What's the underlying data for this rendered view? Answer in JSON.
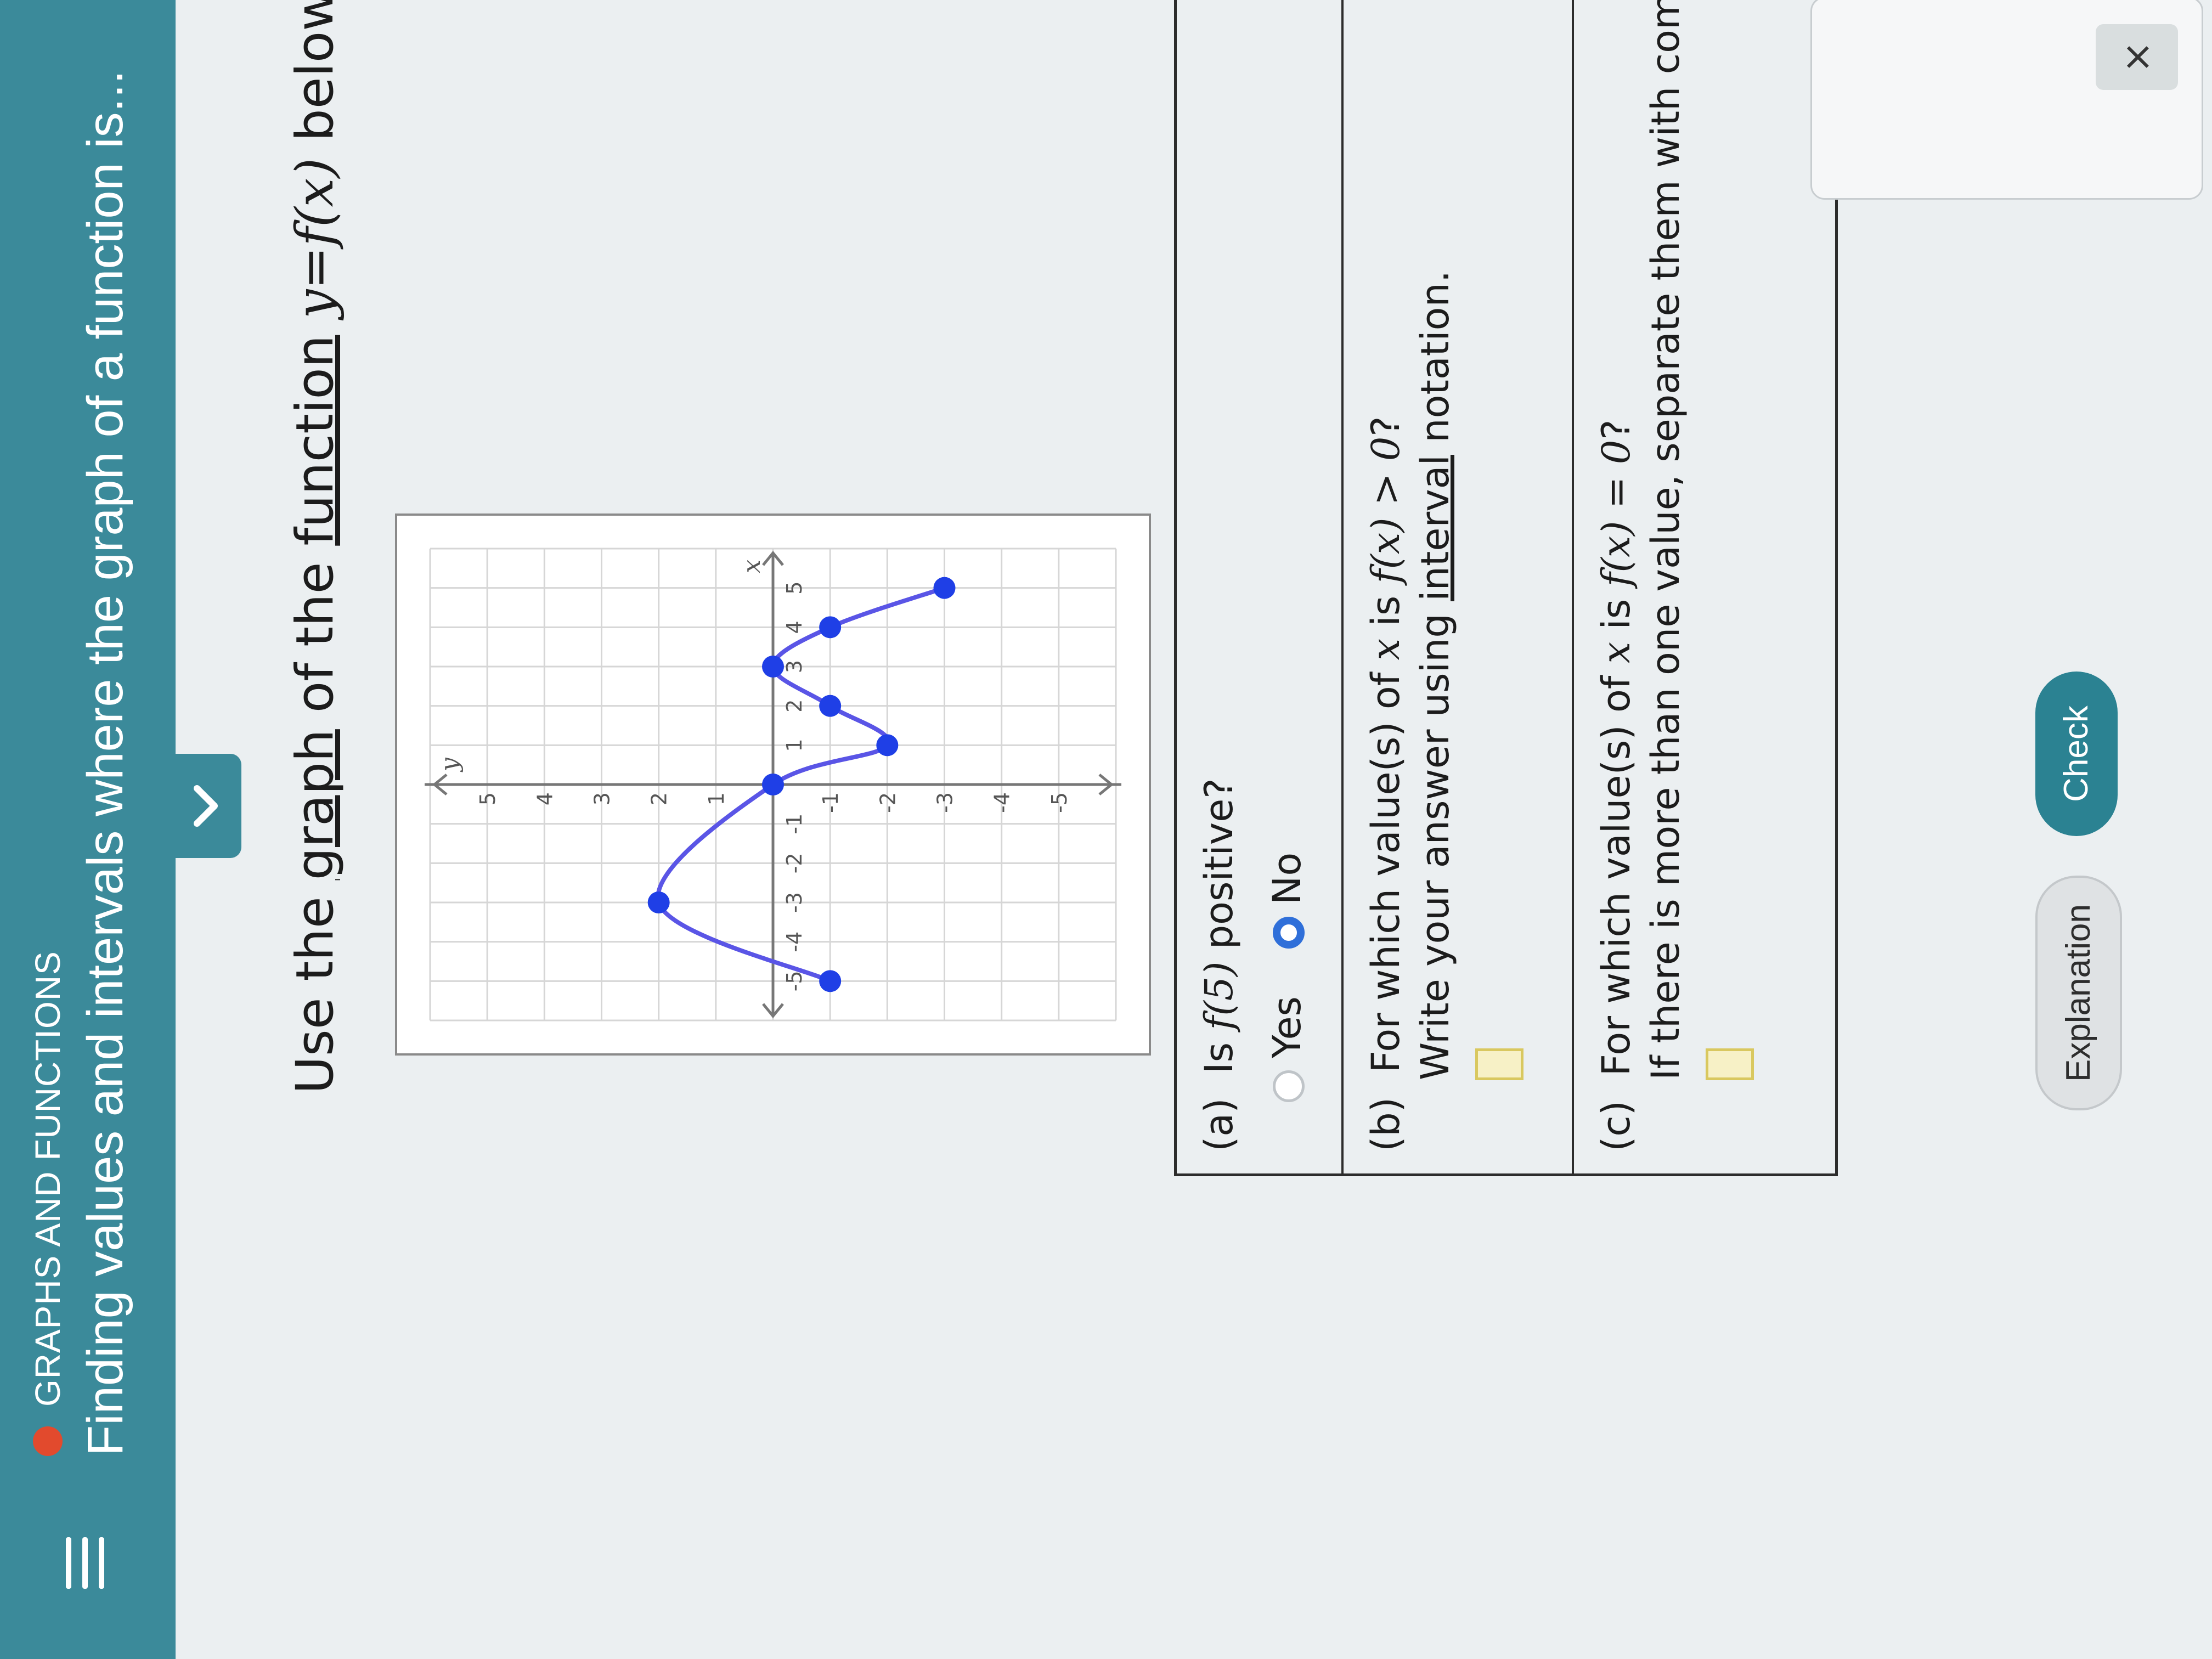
{
  "header": {
    "menu_icon": "hamburger-icon",
    "status_color": "#e24a2d",
    "topic": "GRAPHS AND FUNCTIONS",
    "lesson_title": "Finding values and intervals where the graph of a function is..."
  },
  "problem": {
    "prompt_pre": "Use the ",
    "prompt_link_graph": "graph",
    "prompt_mid1": " of the ",
    "prompt_link_function": "function",
    "prompt_mid2": " ",
    "prompt_math": "y=f(x)",
    "prompt_post": " below to answer the questions."
  },
  "graph": {
    "x_axis_label": "x",
    "y_axis_label": "y",
    "x_ticks": [
      "-5",
      "-4",
      "-3",
      "-2",
      "-1",
      "1",
      "2",
      "3",
      "4",
      "5"
    ],
    "y_ticks": [
      "5",
      "4",
      "3",
      "2",
      "1",
      "-1",
      "-2",
      "-3",
      "-4",
      "-5"
    ]
  },
  "chart_data": {
    "type": "line",
    "x": [
      -5,
      -3,
      0,
      1,
      2,
      3,
      4,
      5
    ],
    "y": [
      -1,
      2,
      0,
      -2,
      -1,
      0,
      -1,
      -3
    ],
    "xlim": [
      -6,
      6
    ],
    "ylim": [
      -6,
      6
    ],
    "grid": true,
    "point_color": "#1f3fe6",
    "line_color": "#5a55e6"
  },
  "questions": {
    "a": {
      "label": "(a)",
      "text_pre": "Is ",
      "text_math": "f(5)",
      "text_post": " positive?",
      "option_yes": "Yes",
      "option_no": "No",
      "selected": "No"
    },
    "b": {
      "label": "(b)",
      "line1_pre": "For which value(s) of ",
      "line1_math": "x",
      "line1_mid": " is ",
      "line1_math2": "f(x) > 0",
      "line1_post": "?",
      "line2_pre": "Write your answer using ",
      "line2_link": "interval",
      "line2_post": " notation."
    },
    "c": {
      "label": "(c)",
      "line1_pre": "For which value(s) of ",
      "line1_math": "x",
      "line1_mid": " is ",
      "line1_math2": "f(x) = 0",
      "line1_post": "?",
      "line2": "If there is more than one value, separate them with commas."
    }
  },
  "buttons": {
    "explanation": "Explanation",
    "check": "Check"
  },
  "side_panel": {
    "close_glyph": "×"
  }
}
